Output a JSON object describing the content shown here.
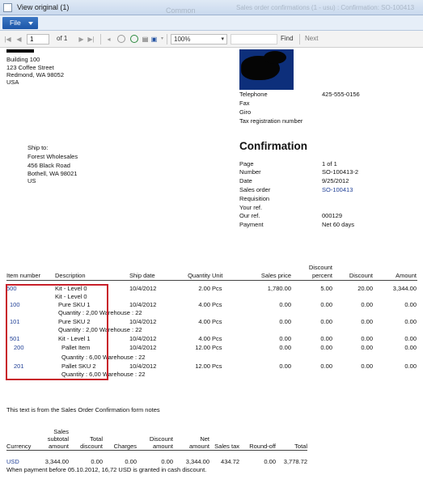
{
  "window": {
    "title": "View original (1)",
    "ghost_left": "Common",
    "ghost_right": "Sales order confirmations (1 - usu) : Confirmation: SO-100413"
  },
  "menu": {
    "file_label": "File"
  },
  "toolbar": {
    "page_value": "1",
    "of_label": "of 1",
    "zoom_value": "100%",
    "find_label": "Find",
    "next_label": "Next"
  },
  "company": {
    "line1": "Building 100",
    "line2": "123 Coffee Street",
    "line3": "Redmond, WA 98052",
    "line4": "USA"
  },
  "contact": {
    "telephone_label": "Telephone",
    "telephone_value": "425-555-0156",
    "fax_label": "Fax",
    "giro_label": "Giro",
    "taxreg_label": "Tax registration number"
  },
  "shipto": {
    "label": "Ship to:",
    "name": "Forest Wholesales",
    "street": "456 Black Road",
    "city": "Bothell, WA 98021",
    "country": "US"
  },
  "confirmation": {
    "heading": "Confirmation",
    "page_label": "Page",
    "page_value": "1  of  1",
    "number_label": "Number",
    "number_value": "SO-100413-2",
    "date_label": "Date",
    "date_value": "9/25/2012",
    "salesorder_label": "Sales order",
    "salesorder_value": "SO-100413",
    "requisition_label": "Requisition",
    "yourref_label": "Your ref.",
    "ourref_label": "Our ref.",
    "ourref_value": "000129",
    "payment_label": "Payment",
    "payment_value": "Net 60 days"
  },
  "lines_header": {
    "item": "Item number",
    "description": "Description",
    "ship_date": "Ship date",
    "quantity": "Quantity",
    "unit": "Unit",
    "sales_price": "Sales price",
    "discount_percent_1": "Discount",
    "discount_percent_2": "percent",
    "discount": "Discount",
    "amount": "Amount"
  },
  "lines": [
    {
      "item": "500",
      "desc": "Kit - Level 0",
      "date": "10/4/2012",
      "qty": "2.00",
      "unit": "Pcs",
      "price": "1,780.00",
      "pct": "5.00",
      "disc": "20.00",
      "amount": "3,344.00"
    },
    {
      "desc": "Kit - Level 0"
    },
    {
      "item": "100",
      "desc": "Pure SKU 1",
      "date": "10/4/2012",
      "qty": "4.00",
      "unit": "Pcs",
      "price": "0.00",
      "pct": "0.00",
      "disc": "0.00",
      "amount": "0.00"
    },
    {
      "desc": "Quantity : 2,00  Warehouse : 22"
    },
    {
      "item": "101",
      "desc": "Pure SKU 2",
      "date": "10/4/2012",
      "qty": "4.00",
      "unit": "Pcs",
      "price": "0.00",
      "pct": "0.00",
      "disc": "0.00",
      "amount": "0.00"
    },
    {
      "desc": "Quantity : 2,00  Warehouse : 22"
    },
    {
      "item": "501",
      "desc": "Kit - Level 1",
      "date": "10/4/2012",
      "qty": "4.00",
      "unit": "Pcs",
      "price": "0.00",
      "pct": "0.00",
      "disc": "0.00",
      "amount": "0.00"
    },
    {
      "item": "200",
      "desc": "Pallet Item",
      "date": "10/4/2012",
      "qty": "12.00",
      "unit": "Pcs",
      "price": "0.00",
      "pct": "0.00",
      "disc": "0.00",
      "amount": "0.00"
    },
    {
      "desc": "Quantity : 6,00  Warehouse : 22"
    },
    {
      "item": "201",
      "desc": "Pallet SKU 2",
      "date": "10/4/2012",
      "qty": "12.00",
      "unit": "Pcs",
      "price": "0.00",
      "pct": "0.00",
      "disc": "0.00",
      "amount": "0.00"
    },
    {
      "desc": "Quantity : 6,00  Warehouse : 22"
    }
  ],
  "notes": "This text is from the Sales Order Confirmation form notes",
  "totals_header": {
    "currency": "Currency",
    "subtotal_1": "Sales",
    "subtotal_2": "subtotal",
    "subtotal_3": "amount",
    "totdisc_1": "Total",
    "totdisc_2": "discount",
    "charges": "Charges",
    "discamt_1": "Discount",
    "discamt_2": "amount",
    "net_1": "Net",
    "net_2": "amount",
    "salestax": "Sales tax",
    "roundoff": "Round-off",
    "total": "Total"
  },
  "totals": {
    "currency": "USD",
    "subtotal": "3,344.00",
    "totdisc": "0.00",
    "charges": "0.00",
    "discamt": "0.00",
    "net": "3,344.00",
    "salestax": "434.72",
    "roundoff": "0.00",
    "total": "3,778.72"
  },
  "cash_discount_note": "When payment before 05.10.2012, 16,72 USD is granted in cash discount."
}
